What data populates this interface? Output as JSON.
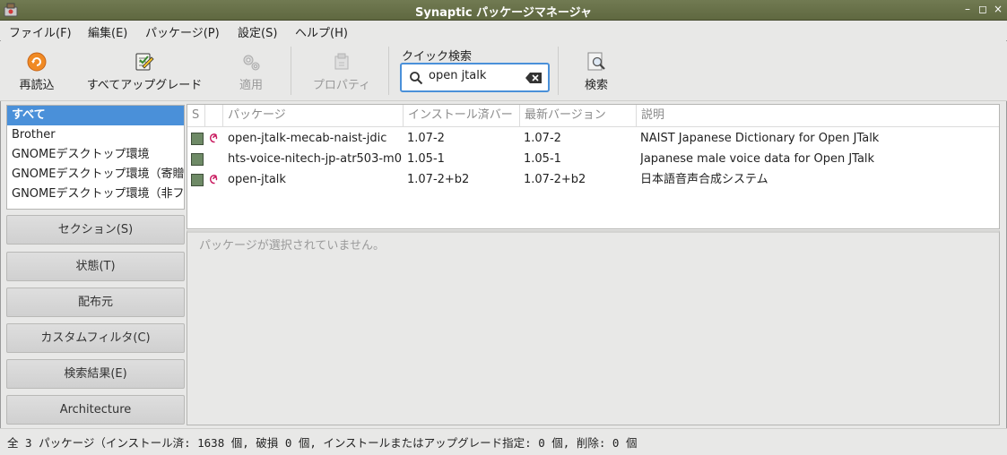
{
  "window": {
    "title": "Synaptic パッケージマネージャ",
    "buttons": [
      "–",
      "◻",
      "×"
    ]
  },
  "menu": [
    "ファイル(F)",
    "編集(E)",
    "パッケージ(P)",
    "設定(S)",
    "ヘルプ(H)"
  ],
  "toolbar": {
    "reload": "再読込",
    "upgrade_all": "すべてアップグレード",
    "apply": "適用",
    "properties": "プロパティ",
    "search": "検索"
  },
  "quick_search": {
    "label": "クイック検索",
    "value": "open jtalk"
  },
  "filter_list": [
    "すべて",
    "Brother",
    "GNOMEデスクトップ環境",
    "GNOMEデスクトップ環境（寄贈",
    "GNOMEデスクトップ環境（非フ"
  ],
  "filter_buttons": [
    "セクション(S)",
    "状態(T)",
    "配布元",
    "カスタムフィルタ(C)",
    "検索結果(E)",
    "Architecture"
  ],
  "columns": {
    "s": "S",
    "package": "パッケージ",
    "installed": "インストール済バー",
    "latest": "最新バージョン",
    "description": "説明"
  },
  "packages": [
    {
      "name": "open-jtalk-mecab-naist-jdic",
      "installed": "1.07-2",
      "latest": "1.07-2",
      "description": "NAIST Japanese Dictionary for Open JTalk",
      "debian": true
    },
    {
      "name": "hts-voice-nitech-jp-atr503-m0",
      "installed": "1.05-1",
      "latest": "1.05-1",
      "description": "Japanese male voice data for Open JTalk",
      "debian": false
    },
    {
      "name": "open-jtalk",
      "installed": "1.07-2+b2",
      "latest": "1.07-2+b2",
      "description": "日本語音声合成システム",
      "debian": true
    }
  ],
  "detail_message": "パッケージが選択されていません。",
  "status_text": "全 3 パッケージ（インストール済: 1638 個, 破損 0 個, インストールまたはアップグレード指定: 0 個, 削除: 0 個",
  "colors": {
    "accent": "#4a90d9",
    "titlebar": "#6b744b",
    "installed_box": "#6e8a66",
    "debian": "#c7135a"
  }
}
